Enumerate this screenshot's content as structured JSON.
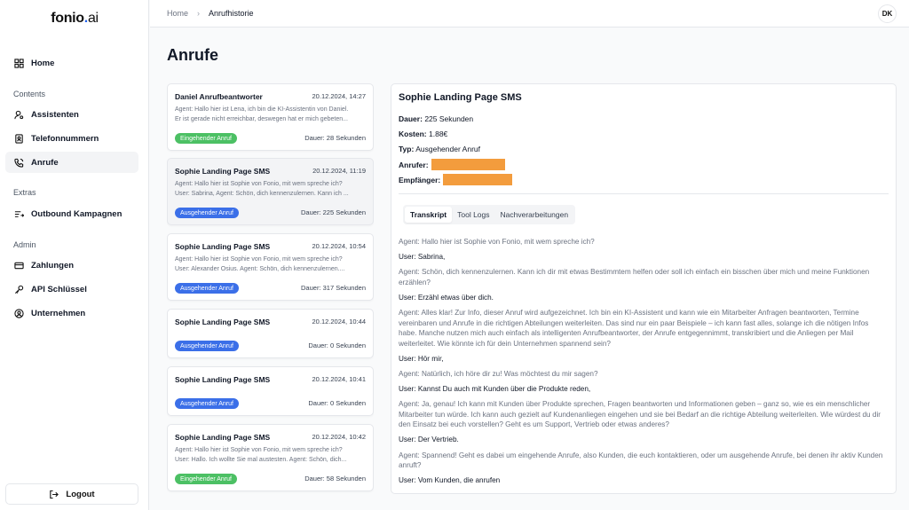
{
  "app": {
    "logo_main": "fonio",
    "logo_dot": ".",
    "logo_suffix": "ai"
  },
  "sidebar": {
    "home": "Home",
    "contents_label": "Contents",
    "assistenten": "Assistenten",
    "telefonnummern": "Telefonnummern",
    "anrufe": "Anrufe",
    "extras_label": "Extras",
    "outbound": "Outbound Kampagnen",
    "admin_label": "Admin",
    "zahlungen": "Zahlungen",
    "api": "API Schlüssel",
    "unternehmen": "Unternehmen",
    "logout": "Logout"
  },
  "breadcrumb": {
    "home": "Home",
    "sep": "›",
    "current": "Anrufhistorie"
  },
  "user": {
    "initials": "DK"
  },
  "page": {
    "title": "Anrufe"
  },
  "calls": [
    {
      "name": "Daniel Anrufbeantworter",
      "date": "20.12.2024, 14:27",
      "line1": "Agent: Hallo hier ist Lena, ich bin die KI-Assistentin von Daniel.",
      "line2": "Er ist gerade nicht erreichbar, deswegen hat er mich gebeten...",
      "badge": "Eingehender Anruf",
      "duration": "Dauer: 28 Sekunden"
    },
    {
      "name": "Sophie Landing Page SMS",
      "date": "20.12.2024, 11:19",
      "line1": "Agent: Hallo hier ist Sophie von Fonio, mit wem spreche ich?",
      "line2": "User: Sabrina, Agent: Schön, dich kennenzulernen. Kann ich ...",
      "badge": "Ausgehender Anruf",
      "duration": "Dauer: 225 Sekunden"
    },
    {
      "name": "Sophie Landing Page SMS",
      "date": "20.12.2024, 10:54",
      "line1": "Agent: Hallo hier ist Sophie von Fonio, mit wem spreche ich?",
      "line2": "User: Alexander Osius. Agent: Schön, dich kennenzulernen....",
      "badge": "Ausgehender Anruf",
      "duration": "Dauer: 317 Sekunden"
    },
    {
      "name": "Sophie Landing Page SMS",
      "date": "20.12.2024, 10:44",
      "line1": "",
      "line2": "",
      "badge": "Ausgehender Anruf",
      "duration": "Dauer: 0 Sekunden"
    },
    {
      "name": "Sophie Landing Page SMS",
      "date": "20.12.2024, 10:41",
      "line1": "",
      "line2": "",
      "badge": "Ausgehender Anruf",
      "duration": "Dauer: 0 Sekunden"
    },
    {
      "name": "Sophie Landing Page SMS",
      "date": "20.12.2024, 10:42",
      "line1": "Agent: Hallo hier ist Sophie von Fonio, mit wem spreche ich?",
      "line2": "User: Hallo. Ich wollte Sie mal austesten. Agent: Schön, dich...",
      "badge": "Eingehender Anruf",
      "duration": "Dauer: 58 Sekunden"
    }
  ],
  "detail": {
    "title": "Sophie Landing Page SMS",
    "dauer_label": "Dauer:",
    "dauer_value": "225 Sekunden",
    "kosten_label": "Kosten:",
    "kosten_value": "1.88€",
    "typ_label": "Typ:",
    "typ_value": "Ausgehender Anruf",
    "anrufer_label": "Anrufer:",
    "empfaenger_label": "Empfänger:",
    "redaction_color": "#f39c3d",
    "tabs": [
      "Transkript",
      "Tool Logs",
      "Nachverarbeitungen"
    ],
    "transcript": [
      "Agent: Hallo hier ist Sophie von Fonio, mit wem spreche ich?",
      "User: Sabrina,",
      "Agent: Schön, dich kennenzulernen. Kann ich dir mit etwas Bestimmtem helfen oder soll ich einfach ein bisschen über mich und meine Funktionen erzählen?",
      "User: Erzähl etwas über dich.",
      "Agent: Alles klar! Zur Info, dieser Anruf wird aufgezeichnet. Ich bin ein KI-Assistent und kann wie ein Mitarbeiter Anfragen beantworten, Termine vereinbaren und Anrufe in die richtigen Abteilungen weiterleiten. Das sind nur ein paar Beispiele – ich kann fast alles, solange ich die nötigen Infos habe. Manche nutzen mich auch einfach als intelligenten Anrufbeantworter, der Anrufe entgegennimmt, transkribiert und die Anliegen per Mail weiterleitet. Wie könnte ich für dein Unternehmen spannend sein?",
      "User: Hör mir,",
      "Agent: Natürlich, ich höre dir zu! Was möchtest du mir sagen?",
      "User: Kannst Du auch mit Kunden über die Produkte reden,",
      "Agent: Ja, genau! Ich kann mit Kunden über Produkte sprechen, Fragen beantworten und Informationen geben – ganz so, wie es ein menschlicher Mitarbeiter tun würde. Ich kann auch gezielt auf Kundenanliegen eingehen und sie bei Bedarf an die richtige Abteilung weiterleiten. Wie würdest du dir den Einsatz bei euch vorstellen? Geht es um Support, Vertrieb oder etwas anderes?",
      "User: Der Vertrieb.",
      "Agent: Spannend! Geht es dabei um eingehende Anrufe, also Kunden, die euch kontaktieren, oder um ausgehende Anrufe, bei denen ihr aktiv Kunden anruft?",
      "User: Vom Kunden, die anrufen"
    ]
  }
}
